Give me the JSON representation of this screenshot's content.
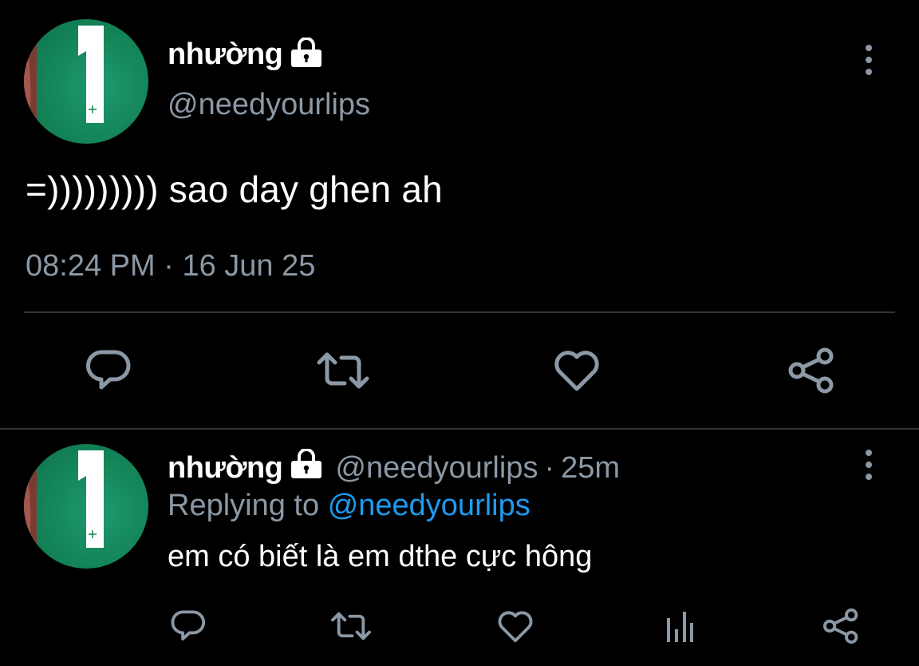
{
  "main_tweet": {
    "display_name": "nhường",
    "handle": "@needyourlips",
    "text": "=))))))))) sao day ghen ah",
    "time": "08:24 PM",
    "separator": "·",
    "date": "16 Jun 25",
    "actions": [
      "reply-icon",
      "retweet-icon",
      "like-icon",
      "share-icon"
    ]
  },
  "reply_tweet": {
    "display_name": "nhường",
    "handle": "@needyourlips",
    "separator": "·",
    "age": "25m",
    "replying_label": "Replying to",
    "replying_handle": "@needyourlips",
    "text": "em có biết là em dthe cực hông",
    "actions": [
      "reply-icon",
      "retweet-icon",
      "like-icon",
      "analytics-icon",
      "share-icon"
    ]
  },
  "colors": {
    "background": "#000000",
    "muted": "#8b98a5",
    "link": "#1d9bf0",
    "divider": "#2f3336",
    "avatar_green": "#138457"
  },
  "icons": {
    "lock": "lock-icon",
    "menu": "more-vertical-icon"
  }
}
